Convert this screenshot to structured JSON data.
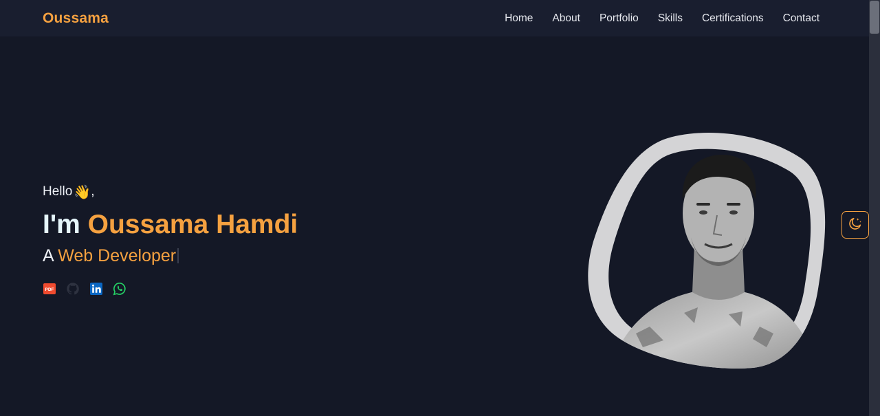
{
  "nav": {
    "brand": "Oussama",
    "links": [
      "Home",
      "About",
      "Portfolio",
      "Skills",
      "Certifications",
      "Contact"
    ]
  },
  "hero": {
    "greeting": "Hello",
    "greeting_suffix": ",",
    "wave_emoji": "👋",
    "im": "I'm",
    "name": "Oussama Hamdi",
    "role_prefix": "A",
    "role": "Web Developer"
  },
  "socials": [
    {
      "icon": "pdf-icon",
      "color": "#f04b2f"
    },
    {
      "icon": "github-icon",
      "color": "#2e3240"
    },
    {
      "icon": "linkedin-icon",
      "color": "#0a66c2"
    },
    {
      "icon": "whatsapp-icon",
      "color": "#25d366"
    }
  ],
  "colors": {
    "accent": "#f5a140",
    "background": "#141826",
    "navbar": "#191e2f",
    "text": "#eef1f6"
  },
  "theme_toggle": {
    "icon": "moon-stars-icon"
  }
}
